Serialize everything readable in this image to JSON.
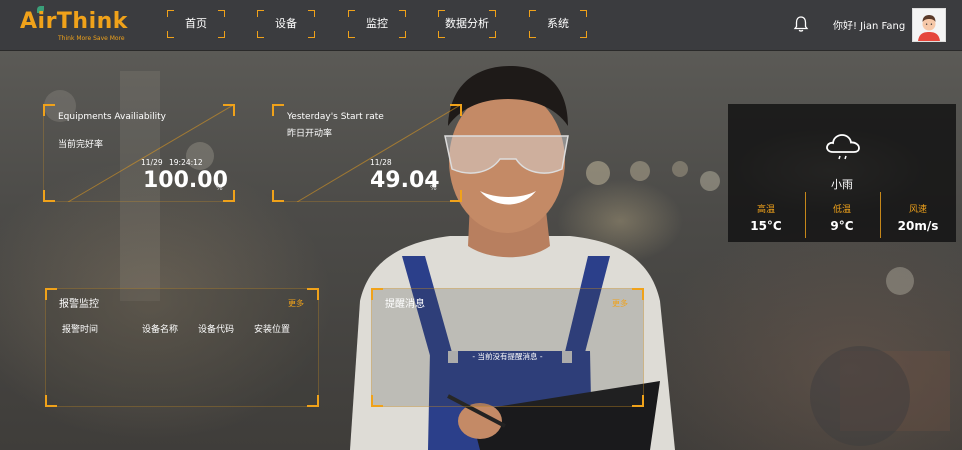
{
  "brand": {
    "name": "AirThink",
    "tagline": "Think More Save More"
  },
  "nav": [
    {
      "label": "首页"
    },
    {
      "label": "设备"
    },
    {
      "label": "监控"
    },
    {
      "label": "数据分析"
    },
    {
      "label": "系统"
    }
  ],
  "user": {
    "greeting": "你好! Jian Fang"
  },
  "kpi": {
    "availability": {
      "title_en": "Equipments Availiability",
      "title_zh": "当前完好率",
      "date": "11/29",
      "time": "19:24:12",
      "value": "100.00",
      "unit": "%"
    },
    "start_rate": {
      "title_en": "Yesterday's Start rate",
      "title_zh": "昨日开动率",
      "date": "11/28",
      "value": "49.04",
      "unit": "%"
    }
  },
  "alarm": {
    "title": "报警监控",
    "more": "更多",
    "columns": [
      "报警时间",
      "设备名称",
      "设备代码",
      "安装位置"
    ]
  },
  "reminder": {
    "title": "提醒消息",
    "more": "更多",
    "empty": "- 当前没有提醒消息 -"
  },
  "weather": {
    "icon": "cloud-rain-icon",
    "condition": "小雨",
    "high_label": "高温",
    "high_value": "15°C",
    "low_label": "低温",
    "low_value": "9°C",
    "wind_label": "风速",
    "wind_value": "20m/s"
  },
  "colors": {
    "accent": "#f0a21a",
    "header_bg": "#3b3c3f",
    "leaf": "#3aa07a"
  }
}
